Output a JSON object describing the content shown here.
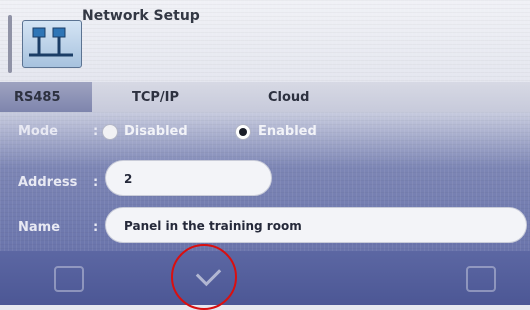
{
  "header": {
    "title": "Network Setup",
    "icon": "network-icon"
  },
  "tabs": [
    {
      "label": "RS485",
      "active": true
    },
    {
      "label": "TCP/IP",
      "active": false
    },
    {
      "label": "Cloud",
      "active": false
    }
  ],
  "form": {
    "mode": {
      "label": "Mode",
      "colon": ":",
      "options": [
        {
          "label": "Disabled",
          "selected": false
        },
        {
          "label": "Enabled",
          "selected": true
        }
      ]
    },
    "address": {
      "label": "Address",
      "colon": ":",
      "value": "2"
    },
    "name": {
      "label": "Name",
      "colon": ":",
      "value": "Panel in the training room"
    }
  },
  "footer": {
    "left_icon": "exit-icon",
    "confirm_icon": "check-icon",
    "right_icon": "folder-icon"
  },
  "annotation": {
    "color": "#d90f0f"
  }
}
